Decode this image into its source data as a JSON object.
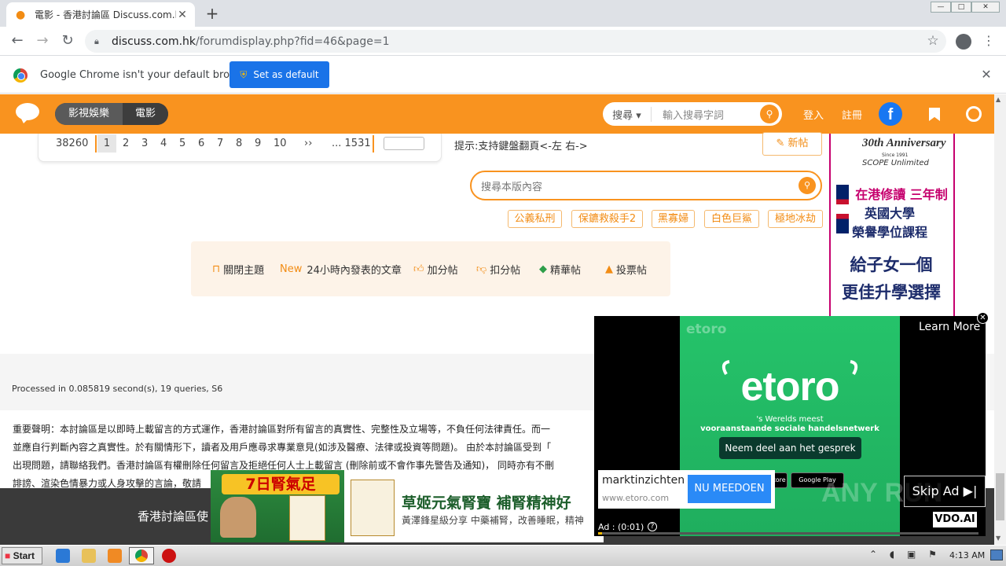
{
  "browser": {
    "tab_title": "電影 - 香港討論區 Discuss.com.hk -",
    "tab_close": "✕",
    "new_tab": "+",
    "url_host": "discuss.com.hk",
    "url_path": "/forumdisplay.php?fid=46&page=1",
    "infobar_text": "Google Chrome isn't your default browser",
    "set_default_label": "Set as default"
  },
  "header": {
    "category": "影視娛樂",
    "subcategory": "電影",
    "search_scope": "搜尋 ▾",
    "search_placeholder": "輸入搜尋字詞",
    "login": "登入",
    "register": "註冊",
    "facebook": "f"
  },
  "pager": {
    "total": "38260",
    "current": "1",
    "pages": [
      "2",
      "3",
      "4",
      "5",
      "6",
      "7",
      "8",
      "9",
      "10"
    ],
    "next": "››",
    "last": "... 1531",
    "tip": "提示:支持鍵盤翻頁<-左 右->"
  },
  "actions": {
    "new_post": "✎ 新帖",
    "board_search_placeholder": "搜尋本版內容"
  },
  "tags": [
    "公義私刑",
    "保鑣救殺手2",
    "黑寡婦",
    "白色巨鯊",
    "極地冰劫"
  ],
  "filters": {
    "closed": "關閉主題",
    "new_badge": "New",
    "recent": "24小時內發表的文章",
    "plus": "加分帖",
    "minus": "扣分帖",
    "digest": "精華帖",
    "poll": "投票帖"
  },
  "footer": {
    "processed": "Processed in 0.085819 second(s), 19 queries, S6",
    "disclaimer_lines": [
      "重要聲明：本討論區是以即時上載留言的方式運作，香港討論區對所有留言的真實性、完整性及立場等，不負任何法律責任。而一",
      "並應自行判斷內容之真實性。於有關情形下，讀者及用戶應尋求專業意見(如涉及醫療、法律或投資等問題)。 由於本討論區受到「",
      "出現問題，請聯絡我們。香港討論區有權刪除任何留言及拒絕任何人士上載留言 (刪除前或不會作事先警告及通知)， 同時亦有不刪",
      "誹謗、渲染色情暴力或人身攻擊的言論，敬請"
    ],
    "dark_text": "香港討論區使"
  },
  "side_ad": {
    "anniversary": "30th Anniversary",
    "since": "Since 1991",
    "brand": "SCOPE Unlimited",
    "line1": "在港修讀 三年制",
    "line2": "英國大學",
    "line3": "榮譽學位課程",
    "line4": "給子女一個",
    "line5": "更佳升學選擇"
  },
  "video_ad": {
    "faint_logo": "etoro",
    "logo": "etoro",
    "tagline1": "'s Werelds meest",
    "tagline2": "vooraanstaande sociale handelsnetwerk",
    "cta": "Neem deel aan het gesprek",
    "learn_more": "Learn More",
    "card_title": "marktinzichten",
    "card_url": "www.etoro.com",
    "card_button": "NU MEEDOEN",
    "skip": "Skip Ad ▶|",
    "brand": "VDO.AI",
    "time": "Ad : (0:01)",
    "help": "?",
    "close": "✕",
    "store1": "App Store",
    "store2": "Google Play",
    "watermark": "ANY RUN",
    "progress_fraction": 0.01
  },
  "banner_ad": {
    "heading": "7日腎氣足",
    "title": "草姬元氣腎寶 補腎精神好",
    "subtitle": "黃澤鋒星級分享 中藥補腎，改善睡眠，精神"
  },
  "taskbar": {
    "start": "Start",
    "clock": "4:13 AM"
  }
}
